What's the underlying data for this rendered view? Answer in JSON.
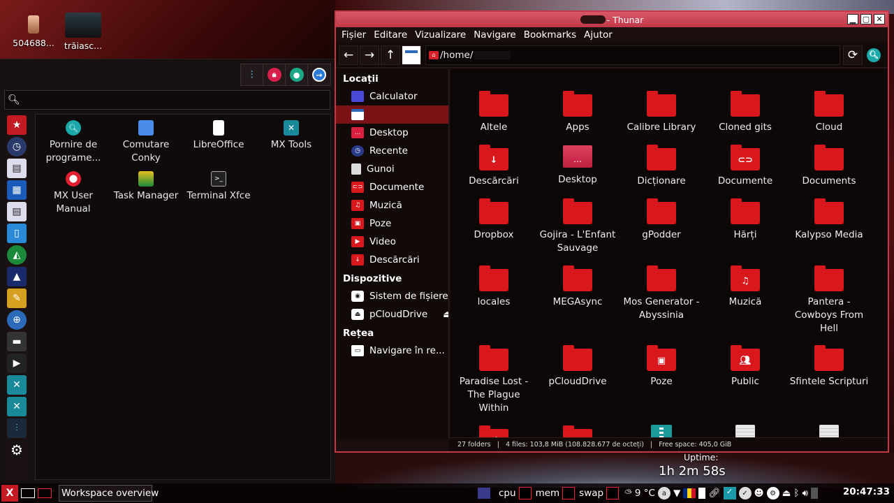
{
  "desktop": {
    "icons": [
      {
        "label": "504688..."
      },
      {
        "label": "trăiasc..."
      }
    ],
    "uptime_label": "Uptime:",
    "uptime_value": "1h 2m 58s"
  },
  "menu": {
    "search_placeholder": "",
    "apps": [
      {
        "label": "Pornire de programe...",
        "icon": "search-icon"
      },
      {
        "label": "Comutare Conky",
        "icon": "conky-icon"
      },
      {
        "label": "LibreOffice",
        "icon": "document-icon"
      },
      {
        "label": "MX Tools",
        "icon": "mx-tools-icon"
      },
      {
        "label": "MX User Manual",
        "icon": "lifebuoy-icon"
      },
      {
        "label": "Task Manager",
        "icon": "task-manager-icon"
      },
      {
        "label": "Terminal Xfce",
        "icon": "terminal-icon"
      }
    ]
  },
  "thunar": {
    "title": "- Thunar",
    "menu": [
      "Fișier",
      "Editare",
      "Vizualizare",
      "Navigare",
      "Bookmarks",
      "Ajutor"
    ],
    "path": "/home/",
    "sidebar": {
      "locatii_header": "Locații",
      "locatii": [
        "Calculator",
        "",
        "Desktop",
        "Recente",
        "Gunoi",
        "Documente",
        "Muzică",
        "Poze",
        "Video",
        "Descărcări"
      ],
      "dispozitive_header": "Dispozitive",
      "dispozitive": [
        "Sistem de fișiere",
        "pCloudDrive"
      ],
      "retea_header": "Rețea",
      "retea": [
        "Navigare în re..."
      ]
    },
    "files": [
      "Altele",
      "Apps",
      "Calibre Library",
      "Cloned gits",
      "Cloud",
      "Descărcări",
      "Desktop",
      "Dicționare",
      "Documente",
      "Documents",
      "Dropbox",
      "Gojira - L'Enfant Sauvage",
      "gPodder",
      "Hărți",
      "Kalypso Media",
      "locales",
      "MEGAsync",
      "Mos Generator - Abyssinia",
      "Muzică",
      "Pantera - Cowboys From Hell",
      "Paradise Lost - The Plague Within",
      "pCloudDrive",
      "Poze",
      "Public",
      "Sfintele Scripturi"
    ],
    "status": "27 folders   |   4 files: 103,8 MiB (108.828.677 de octeți)   |   Free space: 405,0 GiB"
  },
  "panel": {
    "task_label": "Workspace overview",
    "cpu": "cpu",
    "mem": "mem",
    "swap": "swap",
    "weather": "9 °C",
    "clock": "20:47:33"
  },
  "colors": {
    "accent": "#c43848",
    "folder": "#d8181c",
    "selection": "#7a1216"
  }
}
